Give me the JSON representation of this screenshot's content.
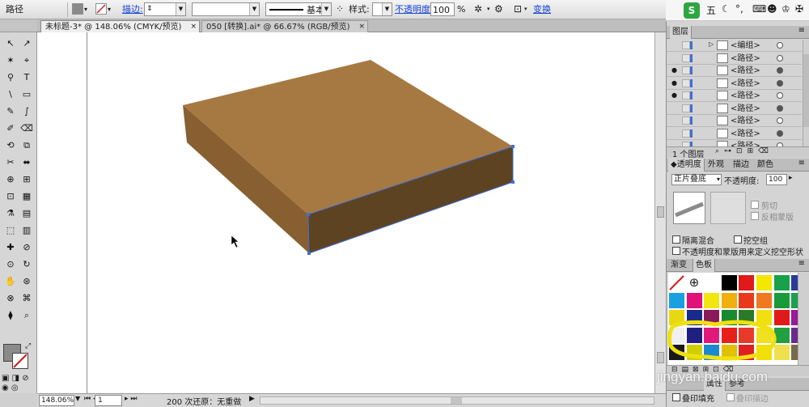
{
  "control_bar": {
    "object_type": "路径",
    "stroke_link": "描边:",
    "basic_label": "基本",
    "style_label": "样式:",
    "opacity_link": "不透明度:",
    "opacity_value": "100",
    "opacity_unit": "%",
    "transform_link": "变换"
  },
  "ime_bar": {
    "brand": "S",
    "mode": "五"
  },
  "document_tabs": [
    {
      "label": "未标题-3* @ 148.06% (CMYK/预览)",
      "close": "×"
    },
    {
      "label": "050 [转换].ai* @ 66.67% (RGB/预览)",
      "close": "×"
    }
  ],
  "tools": [
    "↖",
    "↗",
    "✶",
    "⌖",
    "⚲",
    "T",
    "\\",
    "▭",
    "✎",
    "∫",
    "✐",
    "⌫",
    "⟲",
    "⧉",
    "✂",
    "⬌",
    "⊕",
    "⊞",
    "⊡",
    "▦",
    "⚗",
    "▤",
    "⬚",
    "▥",
    "✚",
    "⊘",
    "⊙",
    "↻",
    "✋",
    "⊛",
    "⊗",
    "⌘",
    "⧫",
    "⌕"
  ],
  "layers_panel": {
    "title": "图层",
    "rows": [
      {
        "name": "<编组>",
        "eye": "",
        "filled": false
      },
      {
        "name": "<路径>",
        "eye": "",
        "filled": false
      },
      {
        "name": "<路径>",
        "eye": "●",
        "filled": true
      },
      {
        "name": "<路径>",
        "eye": "●",
        "filled": true
      },
      {
        "name": "<路径>",
        "eye": "●",
        "filled": false
      },
      {
        "name": "<路径>",
        "eye": "",
        "filled": true
      },
      {
        "name": "<路径>",
        "eye": "",
        "filled": false
      },
      {
        "name": "<路径>",
        "eye": "",
        "filled": true
      },
      {
        "name": "<路径>",
        "eye": "",
        "filled": false
      }
    ],
    "layer_count": "1 个图层"
  },
  "transparency_panel": {
    "tabs": [
      "◆透明度",
      "外观",
      "描边",
      "颜色"
    ],
    "blend_mode": "正片叠底",
    "opacity_label": "不透明度:",
    "opacity_value": "100",
    "clip_label": "剪切",
    "invert_mask_label": "反相蒙版",
    "isolate_blend_label": "隔离混合",
    "knockout_group_label": "挖空组",
    "opacity_mask_label": "不透明度和蒙版用来定义挖空形状"
  },
  "swatches_panel": {
    "tabs": [
      "渐变",
      "色板"
    ],
    "colors": [
      "#ffffff",
      "#ffffff",
      "#ffffff",
      "#000000",
      "#e01a1a",
      "#f5e600",
      "#16a14a",
      "#2a3a9a",
      "#1aa0e0",
      "#e0127a",
      "#f1e610",
      "#f0b010",
      "#e83a1a",
      "#f07820",
      "#1a9a3a",
      "#1aa050",
      "#e8d810",
      "#1a2a8a",
      "#8a1a5a",
      "#1a8a30",
      "#2a7a2a",
      "#f0e010",
      "#e01a1a",
      "#9a1a9a",
      "#f0f0f0",
      "#202080",
      "#e01a7a",
      "#e8201a",
      "#e83a2a",
      "#f0e020",
      "#20a040",
      "#6a2a8a",
      "#1a1a1a",
      "#d0d000",
      "#1a8ad0",
      "#e0c000",
      "#e02020",
      "#f0e000",
      "#f0e050",
      "#7a6a4a"
    ]
  },
  "bottom_panel": {
    "tabs": [
      "属性",
      "参考"
    ],
    "overprint_fill": "叠印填充",
    "overprint_stroke": "叠印描边"
  },
  "status_bar": {
    "zoom": "148.06%",
    "artboard": "1",
    "message": "200 次还原：无重做"
  },
  "watermark": "jingyan.baidu.com",
  "colors": {
    "box_top": "#a77942",
    "box_left": "#875f30",
    "box_front": "#5e4322",
    "selection": "#3f6fd6"
  }
}
